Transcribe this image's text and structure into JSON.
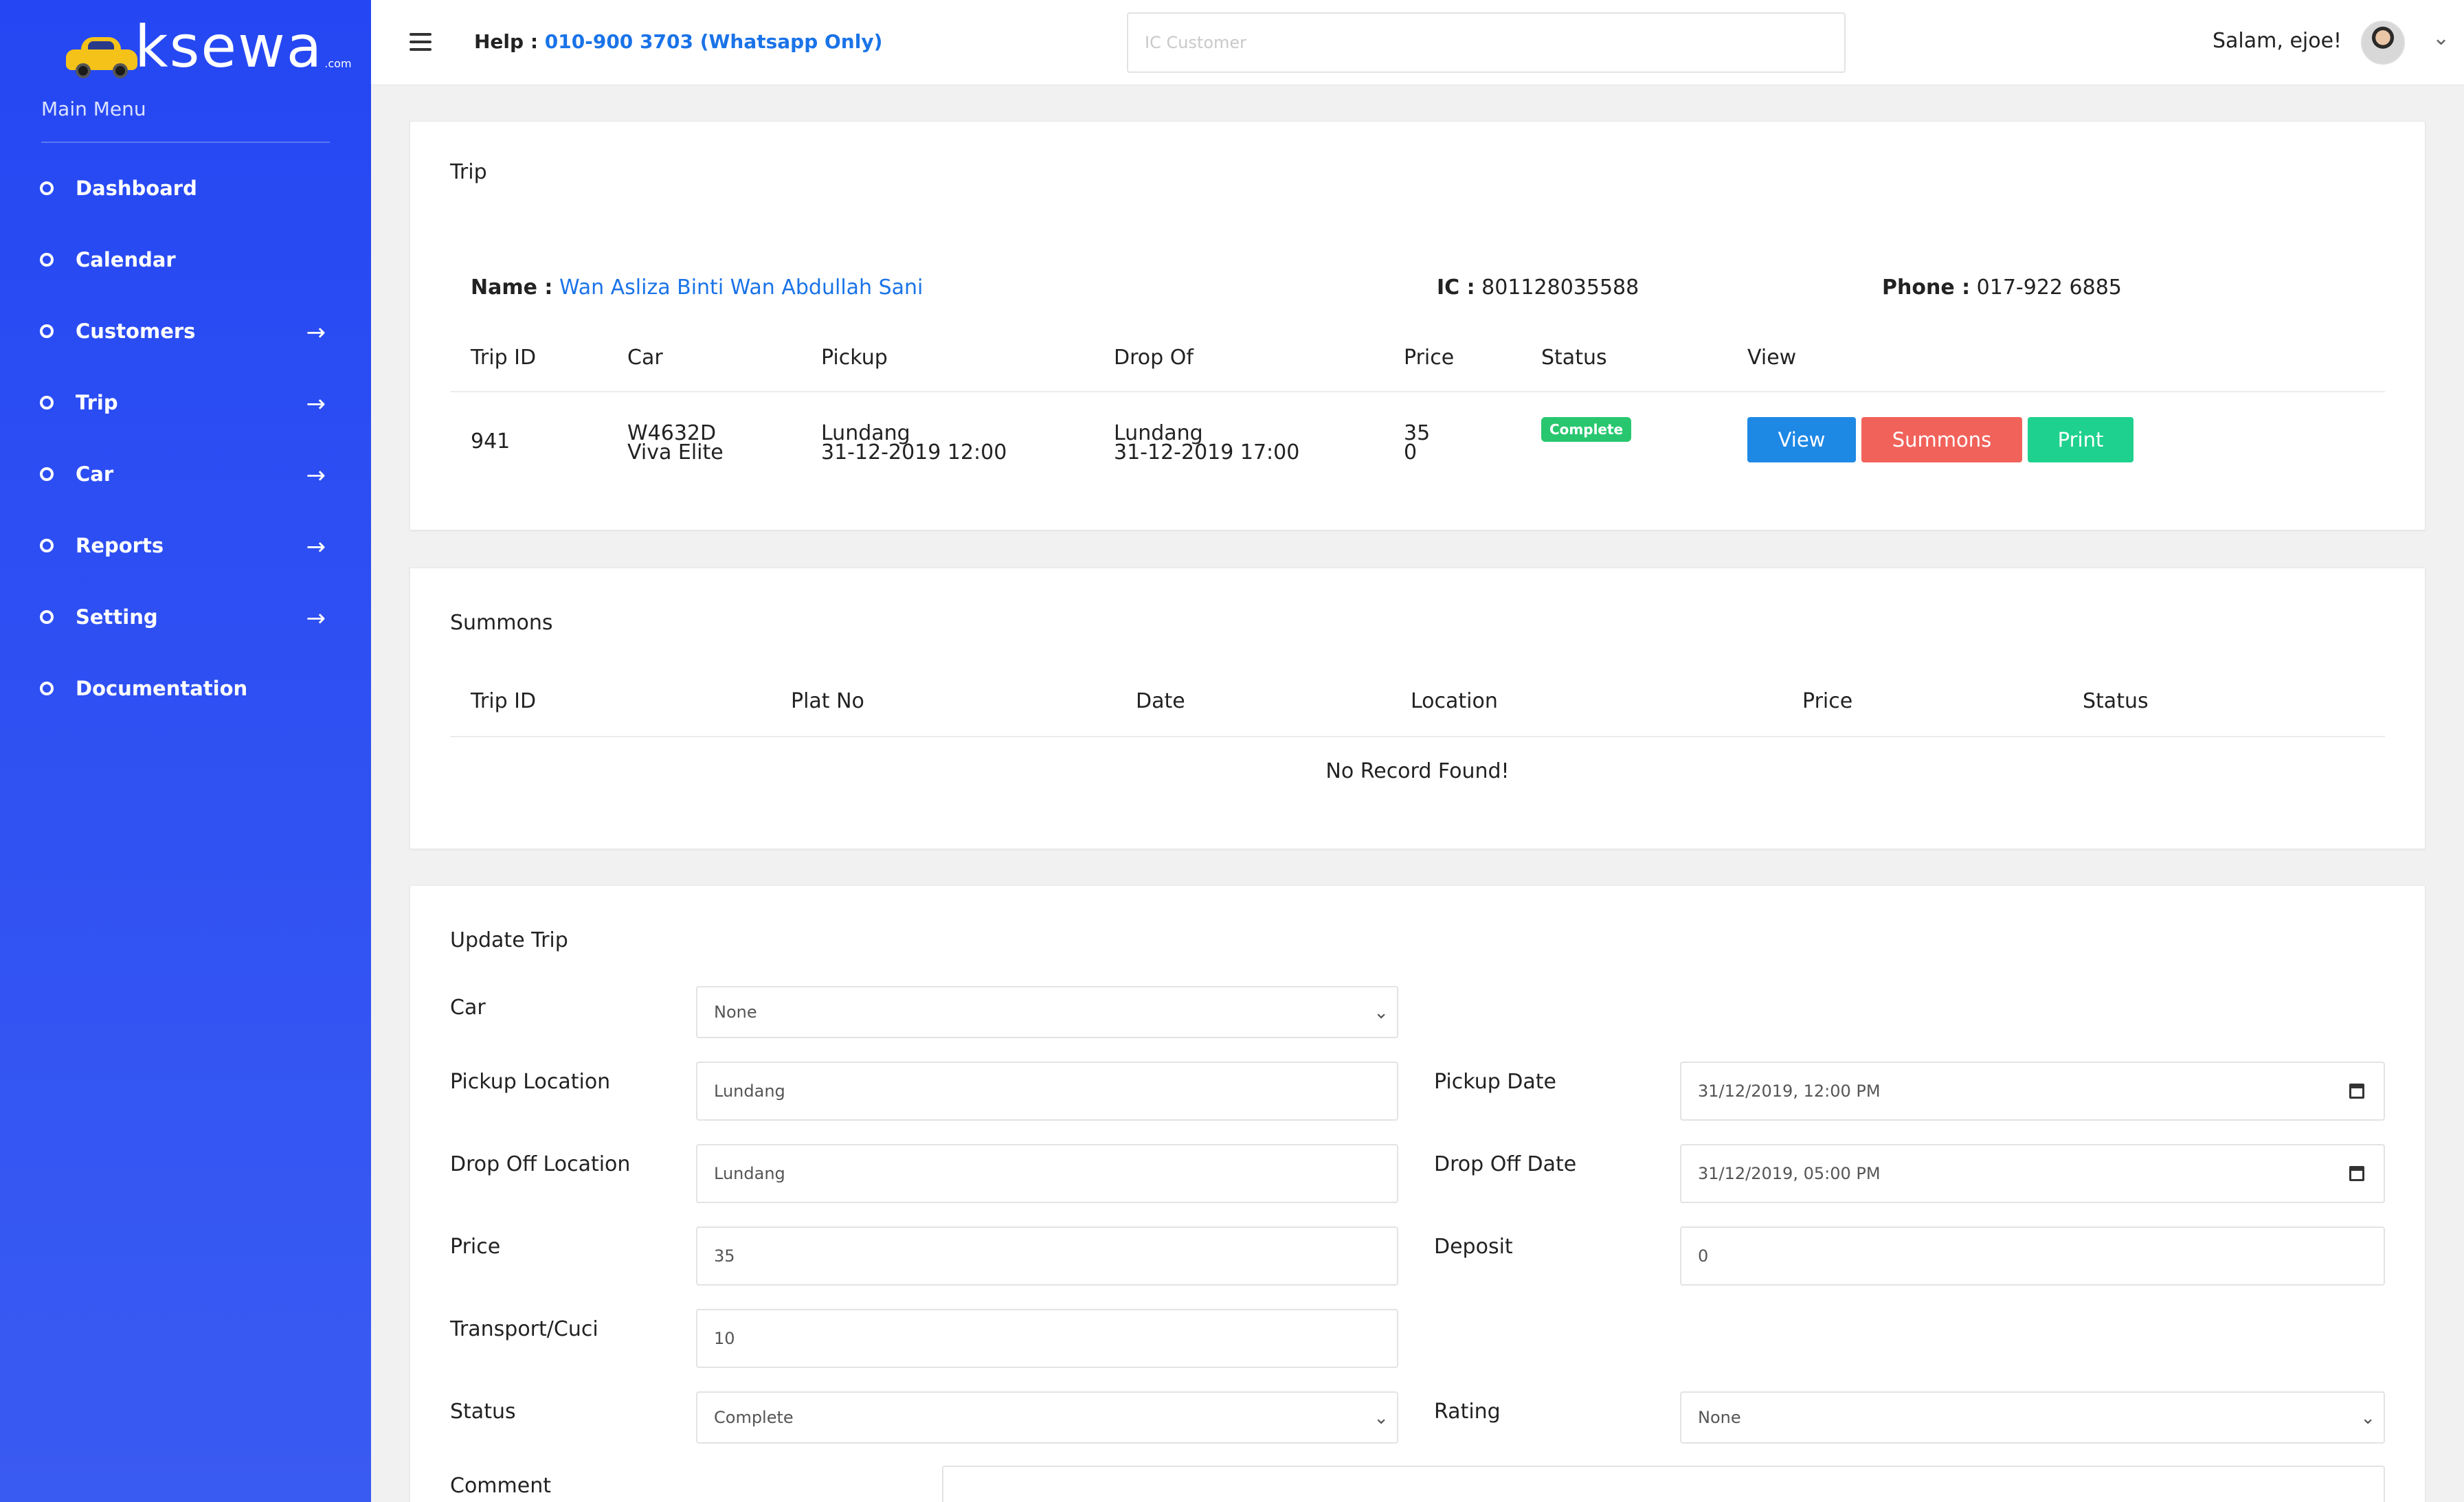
{
  "sidebar": {
    "logo": {
      "brand": "ksewa",
      "suffix": ".com"
    },
    "section_title": "Main Menu",
    "items": [
      {
        "label": "Dashboard",
        "has_arrow": false
      },
      {
        "label": "Calendar",
        "has_arrow": false
      },
      {
        "label": "Customers",
        "has_arrow": true
      },
      {
        "label": "Trip",
        "has_arrow": true
      },
      {
        "label": "Car",
        "has_arrow": true
      },
      {
        "label": "Reports",
        "has_arrow": true
      },
      {
        "label": "Setting",
        "has_arrow": true
      },
      {
        "label": "Documentation",
        "has_arrow": false
      }
    ],
    "arrow_glyph": "→"
  },
  "topbar": {
    "help_label": "Help :",
    "help_number": "010-900 3703 (Whatsapp Only)",
    "search_placeholder": "IC Customer",
    "search_value": "",
    "greeting": "Salam, ejoe!",
    "menu_icon": "hamburger-icon",
    "dropdown_icon": "chevron-down-icon",
    "dropdown_glyph": "⌄"
  },
  "trip": {
    "title": "Trip",
    "customer": {
      "name_label": "Name :",
      "name": "Wan Asliza Binti Wan Abdullah Sani",
      "ic_label": "IC :",
      "ic": "801128035588",
      "phone_label": "Phone :",
      "phone": "017-922 6885"
    },
    "columns": [
      "Trip ID",
      "Car",
      "Pickup",
      "Drop Of",
      "Price",
      "Status",
      "View"
    ],
    "rows": [
      {
        "trip_id": "941",
        "car_plate": "W4632D",
        "car_model": "Viva Elite",
        "pickup_location": "Lundang",
        "pickup_datetime": "31-12-2019 12:00",
        "drop_location": "Lundang",
        "drop_datetime": "31-12-2019 17:00",
        "price": "35",
        "price_extra": "0",
        "status": "Complete",
        "actions": {
          "view": "View",
          "summons": "Summons",
          "print": "Print"
        }
      }
    ]
  },
  "summons": {
    "title": "Summons",
    "columns": [
      "Trip ID",
      "Plat No",
      "Date",
      "Location",
      "Price",
      "Status"
    ],
    "empty_text": "No Record Found!"
  },
  "update_trip": {
    "title": "Update Trip",
    "fields": {
      "car": {
        "label": "Car",
        "value": "None"
      },
      "pickup_location": {
        "label": "Pickup Location",
        "value": "Lundang"
      },
      "pickup_date": {
        "label": "Pickup Date",
        "value": "31/12/2019, 12:00 PM"
      },
      "drop_location": {
        "label": "Drop Off Location",
        "value": "Lundang"
      },
      "drop_date": {
        "label": "Drop Off Date",
        "value": "31/12/2019, 05:00 PM"
      },
      "price": {
        "label": "Price",
        "value": "35"
      },
      "deposit": {
        "label": "Deposit",
        "value": "0"
      },
      "transport": {
        "label": "Transport/Cuci",
        "value": "10"
      },
      "status": {
        "label": "Status",
        "value": "Complete"
      },
      "rating": {
        "label": "Rating",
        "value": "None"
      },
      "comment": {
        "label": "Comment",
        "value": ""
      }
    }
  },
  "colors": {
    "sidebar_top": "#2547f3",
    "sidebar_bottom": "#3a5bf2",
    "link": "#1a73e8",
    "btn_view": "#1e88e5",
    "btn_summons": "#f1625a",
    "btn_print": "#1fd18e",
    "badge_complete": "#28c76f"
  }
}
